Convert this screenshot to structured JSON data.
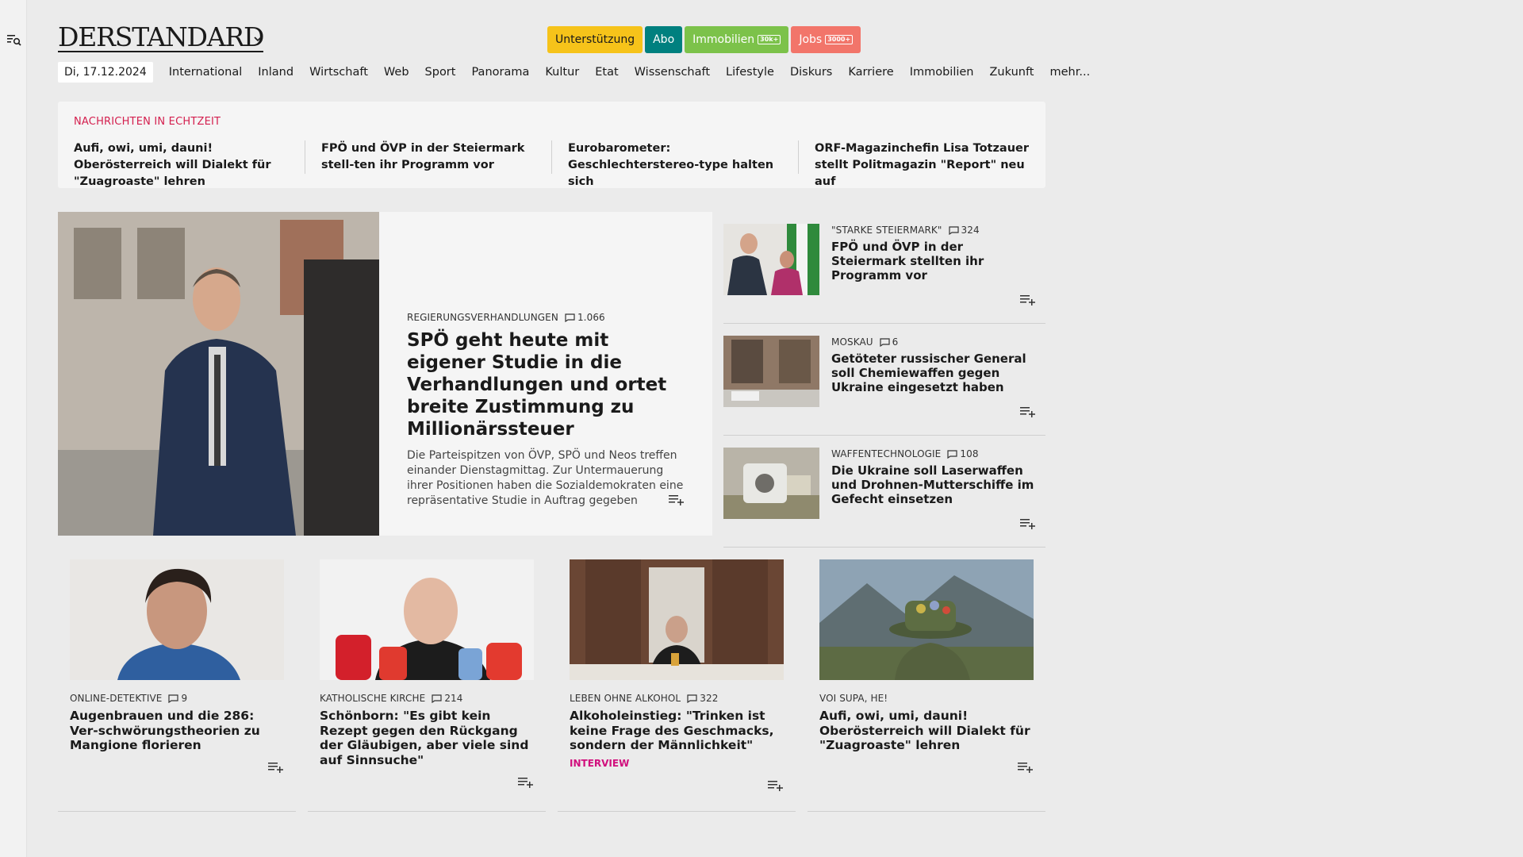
{
  "header": {
    "logo": "DERSTANDARD",
    "tools": [
      {
        "label": "Unterstützung"
      },
      {
        "label": "Abo"
      },
      {
        "label": "Immobilien",
        "badge": "30k+"
      },
      {
        "label": "Jobs",
        "badge": "3000+"
      }
    ],
    "nav": {
      "date": "Di, 17.12.2024",
      "items": [
        "International",
        "Inland",
        "Wirtschaft",
        "Web",
        "Sport",
        "Panorama",
        "Kultur",
        "Etat",
        "Wissenschaft",
        "Lifestyle",
        "Diskurs",
        "Karriere",
        "Immobilien",
        "Zukunft",
        "mehr..."
      ]
    }
  },
  "ticker": {
    "label": "NACHRICHTEN IN ECHTZEIT",
    "items": [
      "Aufi, owi, umi, dauni! Oberösterreich will Dialekt für \"Zuagroaste\" lehren",
      "FPÖ und ÖVP in der Steiermark stell-ten ihr Programm vor",
      "Eurobarometer: Geschlechterstereo-type halten sich",
      "ORF-Magazinchefin Lisa Totzauer stellt Politmagazin \"Report\" neu auf"
    ]
  },
  "hero": {
    "kicker": "REGIERUNGSVERHANDLUNGEN",
    "comments": "1.066",
    "title": "SPÖ geht heute mit eigener Studie in die Verhandlungen und ortet breite Zustimmung zu Millionärssteuer",
    "teaser": "Die Parteispitzen von ÖVP, SPÖ und Neos treffen einander Dienstagmittag. Zur Untermauerung ihrer Positionen haben die Sozialdemokraten eine repräsentative Studie in Auftrag gegeben"
  },
  "side": [
    {
      "kicker": "\"STARKE STEIERMARK\"",
      "comments": "324",
      "title": "FPÖ und ÖVP in der Steiermark stellten ihr Programm vor"
    },
    {
      "kicker": "MOSKAU",
      "comments": "6",
      "title": "Getöteter russischer General soll Chemiewaffen gegen Ukraine eingesetzt haben"
    },
    {
      "kicker": "WAFFENTECHNOLOGIE",
      "comments": "108",
      "title": "Die Ukraine soll Laserwaffen und Drohnen-Mutterschiffe im Gefecht einsetzen"
    }
  ],
  "cards": [
    {
      "kicker": "ONLINE-DETEKTIVE",
      "comments": "9",
      "title": "Augenbrauen und die 286: Ver-schwörungstheorien zu Mangione florieren",
      "label": ""
    },
    {
      "kicker": "KATHOLISCHE KIRCHE",
      "comments": "214",
      "title": "Schönborn: \"Es gibt kein Rezept gegen den Rückgang der Gläubigen, aber viele sind auf Sinnsuche\"",
      "label": ""
    },
    {
      "kicker": "LEBEN OHNE ALKOHOL",
      "comments": "322",
      "title": "Alkoholeinstieg: \"Trinken ist keine Frage des Geschmacks, sondern der Männlichkeit\"",
      "label": "INTERVIEW"
    },
    {
      "kicker": "VOI SUPA, HE!",
      "comments": "",
      "title": "Aufi, owi, umi, dauni! Oberösterreich will Dialekt für \"Zuagroaste\" lehren",
      "label": ""
    }
  ]
}
